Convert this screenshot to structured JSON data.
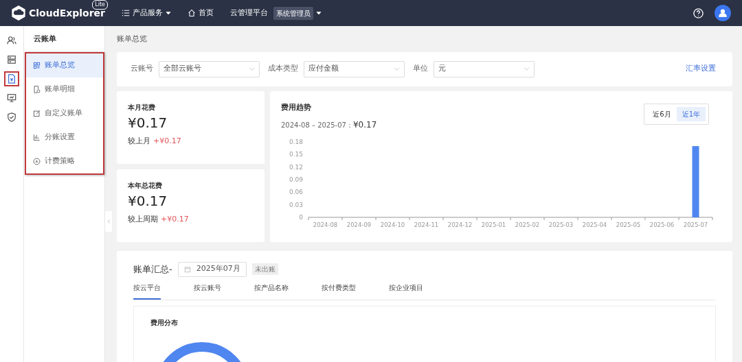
{
  "topbar": {
    "logo": "CloudExplorer",
    "logo_badge": "Lite",
    "menus": [
      {
        "kind": "menu",
        "label": "产品服务"
      },
      {
        "kind": "home",
        "label": "首页"
      },
      {
        "kind": "platform",
        "label": "云管理平台",
        "tag": "系统管理员"
      }
    ]
  },
  "rail": [
    {
      "selected": false,
      "highlighted": false
    },
    {
      "selected": false,
      "highlighted": false
    },
    {
      "selected": true,
      "highlighted": true
    },
    {
      "selected": false,
      "highlighted": false
    },
    {
      "selected": false,
      "highlighted": false
    }
  ],
  "submenu": {
    "title": "云账单",
    "highlighted": true,
    "items": [
      {
        "label": "账单总览",
        "selected": true
      },
      {
        "label": "账单明细",
        "selected": false
      },
      {
        "label": "自定义账单",
        "selected": false
      },
      {
        "label": "分账设置",
        "selected": false
      },
      {
        "label": "计费策略",
        "selected": false
      }
    ]
  },
  "breadcrumb": "账单总览",
  "filters": [
    {
      "label": "云账号",
      "value": "全部云账号"
    },
    {
      "label": "成本类型",
      "value": "应付金额"
    },
    {
      "label": "单位",
      "value": "元"
    }
  ],
  "filter_link": "汇率设置",
  "stats": [
    {
      "title": "本月花费",
      "amount": "¥0.17",
      "compare_label": "较上月",
      "compare_value": "+¥0.17"
    },
    {
      "title": "本年总花费",
      "amount": "¥0.17",
      "compare_label": "较上周期",
      "compare_value": "+¥0.17"
    }
  ],
  "trend": {
    "title": "费用趋势",
    "range": "2024-08 – 2025-07：",
    "total": "¥0.17",
    "periods": [
      {
        "label": "近6月",
        "selected": false
      },
      {
        "label": "近1年",
        "selected": true
      }
    ],
    "chart_data": {
      "type": "bar",
      "categories": [
        "2024-08",
        "2024-09",
        "2024-10",
        "2024-11",
        "2024-12",
        "2025-01",
        "2025-02",
        "2025-03",
        "2025-04",
        "2025-05",
        "2025-06",
        "2025-07"
      ],
      "series": [
        {
          "color": "#4f86f0",
          "values": [
            0,
            0,
            0,
            0,
            0,
            0,
            0,
            0,
            0,
            0,
            0,
            0.17
          ]
        }
      ],
      "ylim": [
        0,
        0.18
      ],
      "yticks": [
        0,
        0.03,
        0.06,
        0.09,
        0.12,
        0.15,
        0.18
      ]
    }
  },
  "summary": {
    "title": "账单汇总-",
    "month": "2025年07月",
    "status": "未出账",
    "tabs": [
      {
        "label": "按云平台",
        "selected": true
      },
      {
        "label": "按云账号",
        "selected": false
      },
      {
        "label": "按产品名称",
        "selected": false
      },
      {
        "label": "按付费类型",
        "selected": false
      },
      {
        "label": "按企业项目",
        "selected": false
      }
    ],
    "panel_title": "费用分布"
  }
}
